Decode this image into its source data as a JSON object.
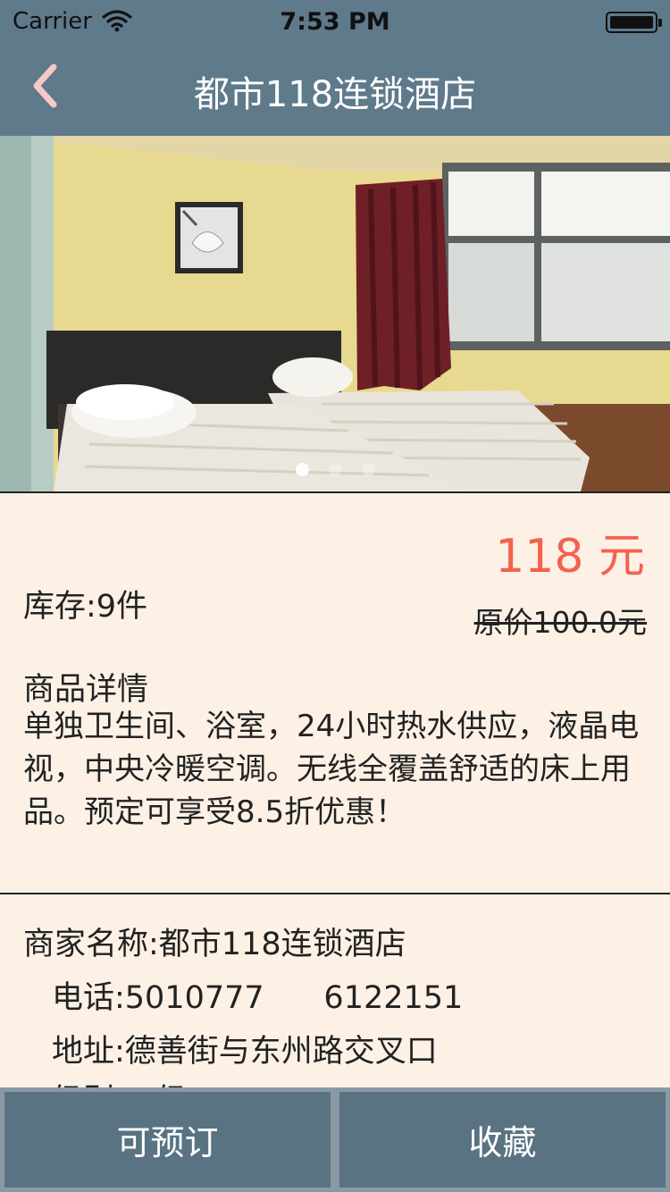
{
  "status_bar": {
    "carrier": "Carrier",
    "time": "7:53 PM",
    "icons": [
      "wifi-icon",
      "battery-icon"
    ]
  },
  "nav": {
    "back_icon": "chevron-left-icon",
    "title": "都市118连锁酒店"
  },
  "gallery": {
    "page_count": 3,
    "current_page": 1
  },
  "product": {
    "price": "118 元",
    "stock": "库存:9件",
    "original_price": "原价100.0元"
  },
  "details": {
    "heading": "商品详情",
    "body": "单独卫生间、浴室，24小时热水供应，液晶电视，中央冷暖空调。无线全覆盖舒适的床上用品。预定可享受8.5折优惠！"
  },
  "merchant": {
    "name": "商家名称:都市118连锁酒店",
    "phone": "电话:5010777      6122151",
    "address": "地址:德善街与东州路交叉口",
    "level": "级别:二级"
  },
  "actions": {
    "book_label": "可预订",
    "favorite_label": "收藏"
  },
  "colors": {
    "nav_bar": "#5e7a8b",
    "background": "#fdf1e6",
    "price": "#f4624e",
    "button": "#597383",
    "back_icon": "#f5c9c4"
  }
}
